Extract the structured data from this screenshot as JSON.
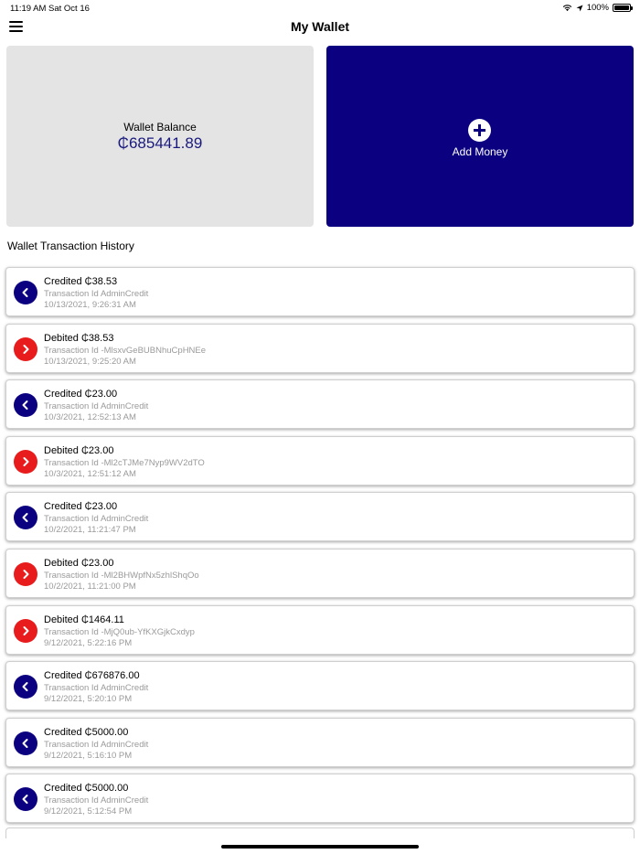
{
  "status": {
    "time": "11:19 AM",
    "date": "Sat Oct 16",
    "battery": "100%"
  },
  "header": {
    "title": "My Wallet"
  },
  "balance": {
    "label": "Wallet Balance",
    "value": "₵685441.89"
  },
  "add_money": {
    "label": "Add Money"
  },
  "history": {
    "title": "Wallet Transaction History",
    "items": [
      {
        "kind": "credit",
        "title": "Credited ₵38.53",
        "txid": "Transaction Id  AdminCredit",
        "date": "10/13/2021, 9:26:31 AM"
      },
      {
        "kind": "debit",
        "title": "Debited ₵38.53",
        "txid": "Transaction Id  -MlsxvGeBUBNhuCpHNEe",
        "date": "10/13/2021, 9:25:20 AM"
      },
      {
        "kind": "credit",
        "title": "Credited ₵23.00",
        "txid": "Transaction Id  AdminCredit",
        "date": "10/3/2021, 12:52:13 AM"
      },
      {
        "kind": "debit",
        "title": "Debited ₵23.00",
        "txid": "Transaction Id  -Ml2cTJMe7Nyp9WV2dTO",
        "date": "10/3/2021, 12:51:12 AM"
      },
      {
        "kind": "credit",
        "title": "Credited ₵23.00",
        "txid": "Transaction Id  AdminCredit",
        "date": "10/2/2021, 11:21:47 PM"
      },
      {
        "kind": "debit",
        "title": "Debited ₵23.00",
        "txid": "Transaction Id  -Ml2BHWpfNx5zhlShqOo",
        "date": "10/2/2021, 11:21:00 PM"
      },
      {
        "kind": "debit",
        "title": "Debited ₵1464.11",
        "txid": "Transaction Id  -MjQ0ub-YfKXGjkCxdyp",
        "date": "9/12/2021, 5:22:16 PM"
      },
      {
        "kind": "credit",
        "title": "Credited ₵676876.00",
        "txid": "Transaction Id  AdminCredit",
        "date": "9/12/2021, 5:20:10 PM"
      },
      {
        "kind": "credit",
        "title": "Credited ₵5000.00",
        "txid": "Transaction Id  AdminCredit",
        "date": "9/12/2021, 5:16:10 PM"
      },
      {
        "kind": "credit",
        "title": "Credited ₵5000.00",
        "txid": "Transaction Id  AdminCredit",
        "date": "9/12/2021, 5:12:54 PM"
      }
    ]
  },
  "colors": {
    "credit": "#0a0080",
    "debit": "#e81c1c"
  },
  "icons": {
    "credit": "chevron-left-icon",
    "debit": "chevron-right-icon"
  }
}
